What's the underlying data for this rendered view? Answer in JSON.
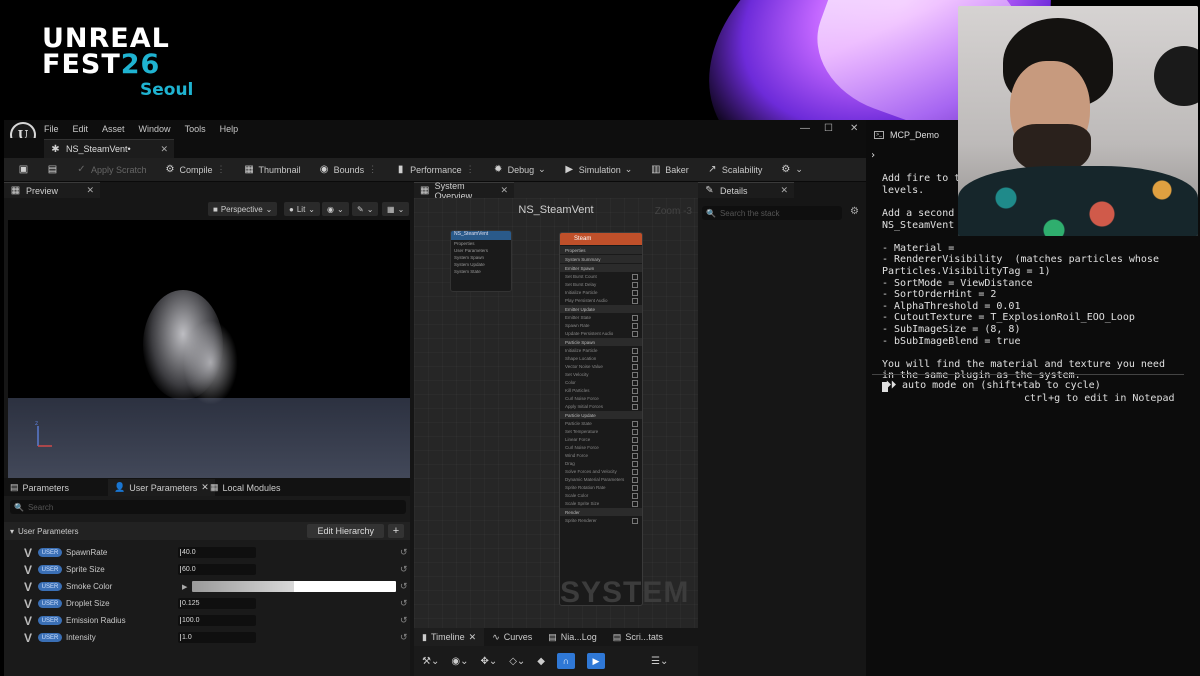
{
  "branding": {
    "line1": "UNREAL",
    "line2_a": "FEST",
    "line2_b": "26",
    "city": "Seoul"
  },
  "editor": {
    "menu": [
      "File",
      "Edit",
      "Asset",
      "Window",
      "Tools",
      "Help"
    ],
    "doc_tab": "NS_SteamVent•",
    "toolbar": {
      "apply_scratch": "Apply Scratch",
      "compile": "Compile",
      "thumbnail": "Thumbnail",
      "bounds": "Bounds",
      "performance": "Performance",
      "debug": "Debug",
      "simulation": "Simulation",
      "baker": "Baker",
      "scalability": "Scalability"
    },
    "preview": {
      "tab": "Preview",
      "perspective": "Perspective",
      "lit": "Lit"
    },
    "params_tabs": {
      "parameters": "Parameters",
      "user_parameters": "User Parameters",
      "local_modules": "Local Modules"
    },
    "params_search": "Search",
    "params_header": "User Parameters",
    "edit_hierarchy": "Edit Hierarchy",
    "user_badge": "USER",
    "params": [
      {
        "name": "SpawnRate",
        "value": "40.0"
      },
      {
        "name": "Sprite Size",
        "value": "60.0"
      },
      {
        "name": "Smoke Color",
        "value": ""
      },
      {
        "name": "Droplet Size",
        "value": "0.125"
      },
      {
        "name": "Emission Radius",
        "value": "100.0"
      },
      {
        "name": "Intensity",
        "value": "1.0"
      }
    ],
    "system_overview": {
      "tab": "System Overview",
      "title": "NS_SteamVent",
      "zoom": "Zoom -3",
      "watermark": "SYSTEM",
      "system_node": {
        "title": "NS_SteamVent",
        "lines": [
          "Properties",
          "User Parameters",
          "System Spawn",
          "System Update",
          "System State"
        ]
      },
      "emitter_node": {
        "title": "Steam",
        "sections": [
          {
            "label": "Properties",
            "lines": []
          },
          {
            "label": "System Summary",
            "lines": []
          },
          {
            "label": "Emitter Spawn",
            "lines": [
              "Set Burst Count",
              "Set Burst Delay",
              "Initialize Particle",
              "Play Persistent Audio"
            ]
          },
          {
            "label": "Emitter Update",
            "lines": [
              "Emitter State",
              "Spawn Rate",
              "Update Persistent Audio"
            ]
          },
          {
            "label": "Particle Spawn",
            "lines": [
              "Initialize Particle",
              "Shape Location",
              "Vector Noise Value",
              "Set Velocity",
              "Color",
              "Kill Particles",
              "Curl Noise Force",
              "Apply Initial Forces"
            ]
          },
          {
            "label": "Particle Update",
            "lines": [
              "Particle State",
              "Set Temperature",
              "Linear Force",
              "Curl Noise Force",
              "Wind Force",
              "Drag",
              "Solve Forces and Velocity",
              "Dynamic Material Parameters",
              "Sprite Rotation Rate",
              "Scale Color",
              "Scale Sprite Size"
            ]
          },
          {
            "label": "Render",
            "lines": [
              "Sprite Renderer"
            ]
          }
        ]
      }
    },
    "bottom_tabs": {
      "timeline": "Timeline",
      "curves": "Curves",
      "niagara_log": "Nia...Log",
      "scratch_stats": "Scri...tats"
    },
    "details": {
      "tab": "Details",
      "search": "Search the stack"
    }
  },
  "terminal": {
    "tab": "MCP_Demo",
    "lines": [
      "Add fire to t",
      "levels.",
      "",
      "Add a second",
      "NS_SteamVent",
      "",
      "- Material =",
      "- RendererVisibility",
      "Particles.VisibilityTag = 1)",
      "- SortMode = ViewDistance",
      "- SortOrderHint = 2",
      "- AlphaThreshold = 0.01",
      "- CutoutTexture = T_ExplosionRoil_EOO_Loop",
      "- SubImageSize = (8, 8)",
      "- bSubImageBlend = true",
      "",
      "You will find the material and texture you need",
      "in the same plugin as the system."
    ],
    "renderer_suffix": "(matches particles whose",
    "auto_arrows": "⏵⏵",
    "auto_mode": "auto mode on",
    "auto_hint": "(shift+tab to cycle)",
    "notepad_hint": "ctrl+g to edit in Notepad"
  }
}
